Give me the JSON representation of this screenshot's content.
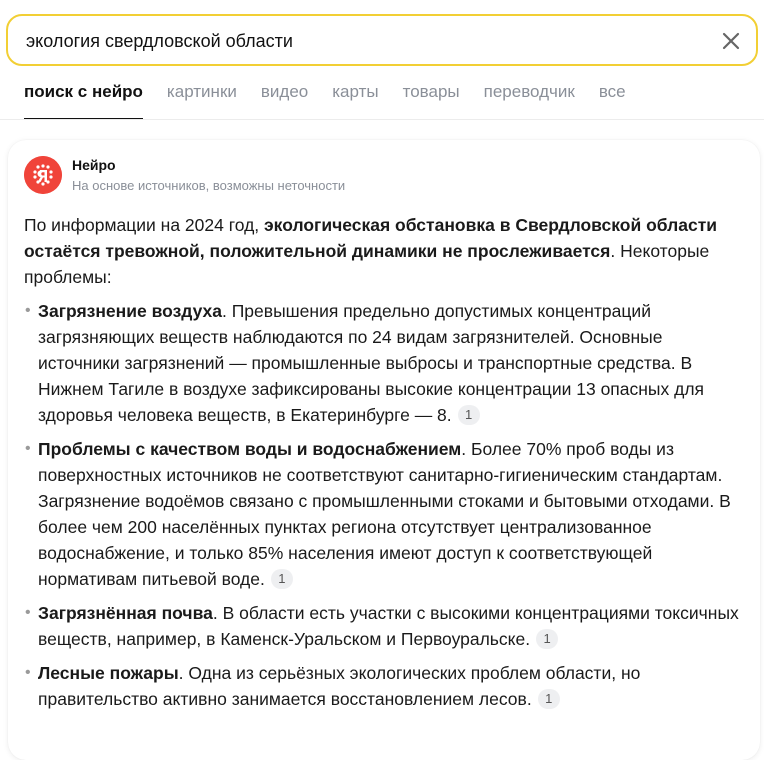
{
  "search": {
    "query": "экология свердловской области"
  },
  "tabs": [
    {
      "label": "поиск с нейро",
      "active": true
    },
    {
      "label": "картинки"
    },
    {
      "label": "видео"
    },
    {
      "label": "карты"
    },
    {
      "label": "товары"
    },
    {
      "label": "переводчик"
    },
    {
      "label": "все"
    }
  ],
  "answer": {
    "source_name": "Нейро",
    "source_note": "На основе источников, возможны неточности",
    "intro": {
      "pre": "По информации на 2024 год, ",
      "bold": "экологическая обстановка в Свердловской области остаётся тревожной, положительной динамики не прослеживается",
      "post": ". Некоторые проблемы:"
    },
    "items": [
      {
        "title": "Загрязнение воздуха",
        "text": ". Превышения предельно допустимых концентраций загрязняющих веществ наблюдаются по 24 видам загрязнителей. Основные источники загрязнений — промышленные выбросы и транспортные средства. В Нижнем Тагиле в воздухе зафиксированы высокие концентрации 13 опасных для здоровья человека веществ, в Екатеринбурге — 8.",
        "cite": "1"
      },
      {
        "title": "Проблемы с качеством воды и водоснабжением",
        "text": ". Более 70% проб воды из поверхностных источников не соответствуют санитарно-гигиеническим стандартам. Загрязнение водоёмов связано с промышленными стоками и бытовыми отходами. В более чем 200 населённых пунктах региона отсутствует централизованное водоснабжение, и только 85% населения имеют доступ к соответствующей нормативам питьевой воде.",
        "cite": "1"
      },
      {
        "title": "Загрязнённая почва",
        "text": ". В области есть участки с высокими концентрациями токсичных веществ, например, в Каменск-Уральском и Первоуральске.",
        "cite": "1"
      },
      {
        "title": "Лесные пожары",
        "text": ". Одна из серьёзных экологических проблем области, но правительство активно занимается восстановлением лесов.",
        "cite": "1"
      }
    ]
  },
  "colors": {
    "search_border": "#f2cf34",
    "logo": "#f0443a",
    "inactive_tab": "#8a8f98"
  }
}
